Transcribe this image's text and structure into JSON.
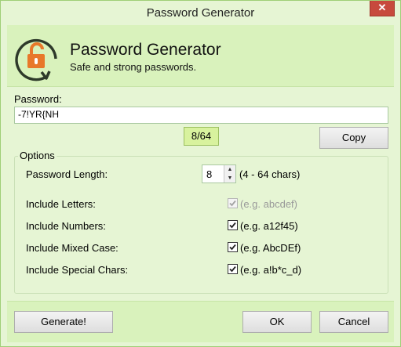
{
  "window": {
    "title": "Password Generator",
    "close_glyph": "✕"
  },
  "header": {
    "title": "Password Generator",
    "subtitle": "Safe and strong passwords.",
    "icon": "padlock-refresh-icon",
    "accent": "#e8782a"
  },
  "password": {
    "label": "Password:",
    "value": "-7!YR{NH",
    "count": "8/64"
  },
  "buttons": {
    "copy": "Copy",
    "generate": "Generate!",
    "ok": "OK",
    "cancel": "Cancel"
  },
  "options": {
    "legend": "Options",
    "length": {
      "label": "Password Length:",
      "value": "8",
      "hint": "(4 - 64 chars)"
    },
    "items": [
      {
        "label": "Include Letters:",
        "example": "(e.g. abcdef)",
        "checked": true,
        "disabled": true
      },
      {
        "label": "Include Numbers:",
        "example": "(e.g. a12f45)",
        "checked": true,
        "disabled": false
      },
      {
        "label": "Include Mixed Case:",
        "example": "(e.g. AbcDEf)",
        "checked": true,
        "disabled": false
      },
      {
        "label": "Include Special Chars:",
        "example": "(e.g. a!b*c_d)",
        "checked": true,
        "disabled": false
      }
    ]
  }
}
